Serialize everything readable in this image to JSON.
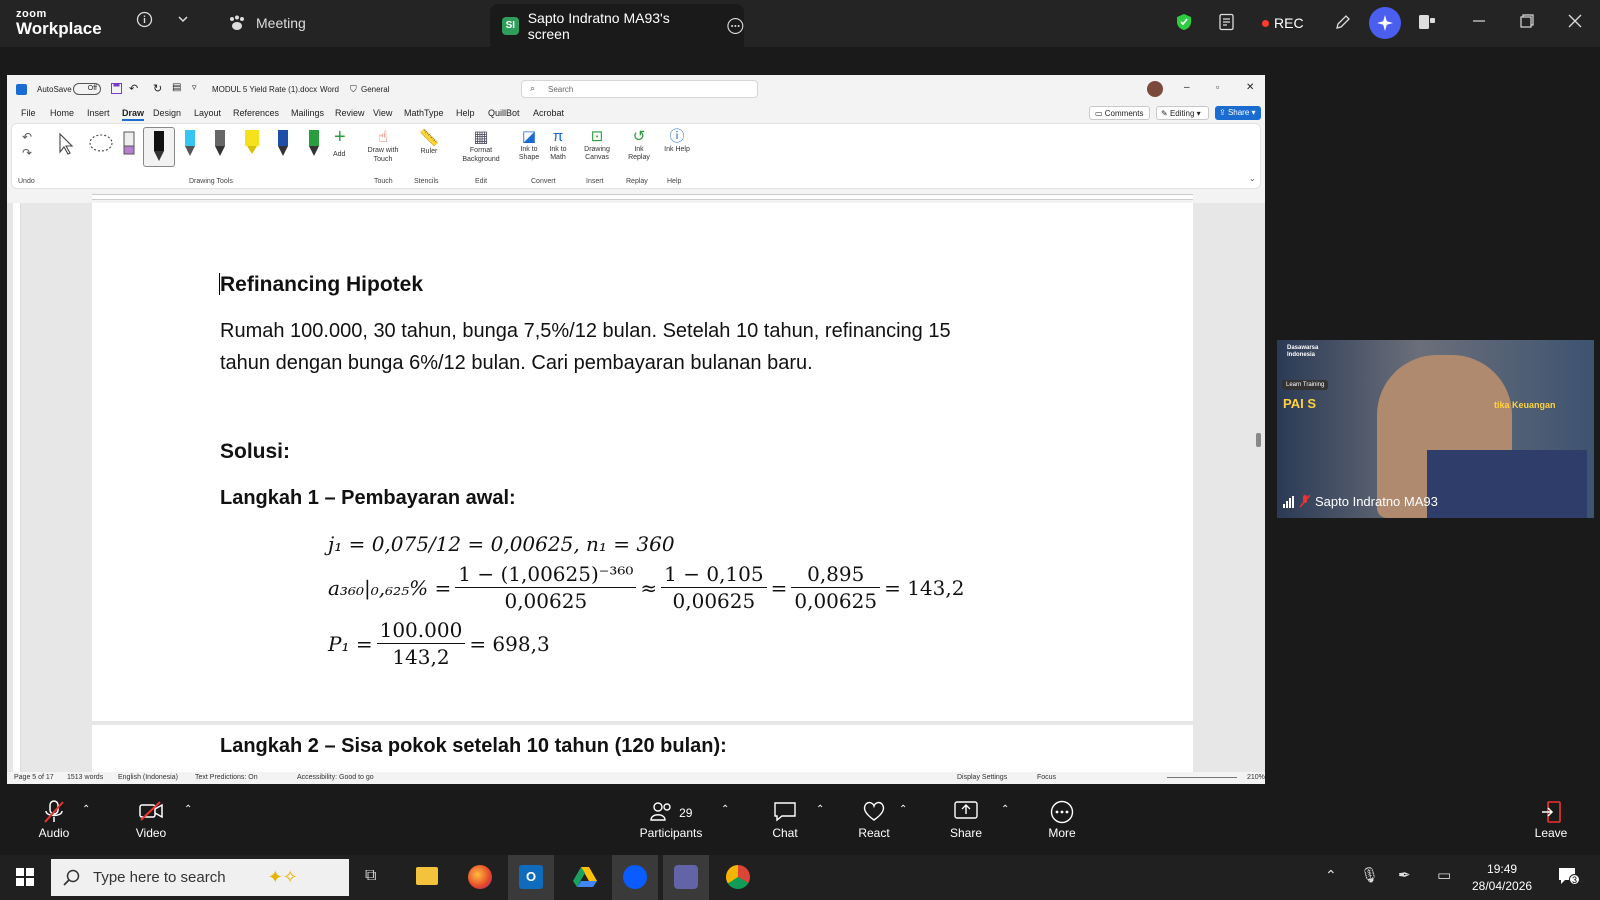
{
  "zoom": {
    "logo_line1": "zoom",
    "logo_line2": "Workplace",
    "meeting_label": "Meeting",
    "screen_tab_badge": "SI",
    "screen_tab_label": "Sapto Indratno MA93's screen",
    "rec_label": "REC"
  },
  "word": {
    "autosave": "AutoSave",
    "autosave_state": "Off",
    "filename": "MODUL 5 Yield Rate (1).docx",
    "app": "Word",
    "sensitivity": "General",
    "search_placeholder": "Search",
    "menu": [
      "File",
      "Home",
      "Insert",
      "Draw",
      "Design",
      "Layout",
      "References",
      "Mailings",
      "Review",
      "View",
      "MathType",
      "Help",
      "QuillBot",
      "Acrobat"
    ],
    "comments": "Comments",
    "editing": "Editing",
    "share": "Share",
    "ribbon": {
      "undo_group": "Undo",
      "drawing_tools_group": "Drawing Tools",
      "add": "Add",
      "draw_with_touch": "Draw with Touch",
      "ruler": "Ruler",
      "format_background": "Format Background",
      "ink_to_shape": "Ink to Shape",
      "ink_to_math": "Ink to Math",
      "drawing_canvas": "Drawing Canvas",
      "ink_replay": "Ink Replay",
      "ink_help": "Ink Help",
      "groups": [
        "Touch",
        "Stencils",
        "Edit",
        "Convert",
        "Insert",
        "Replay",
        "Help"
      ]
    },
    "status": {
      "page": "Page 5 of 17",
      "words": "1513 words",
      "language": "English (Indonesia)",
      "text_predictions": "Text Predictions: On",
      "accessibility": "Accessibility: Good to go",
      "display_settings": "Display Settings",
      "focus": "Focus",
      "zoom": "210%"
    }
  },
  "document": {
    "heading": "Refinancing Hipotek",
    "problem_line1": "Rumah 100.000, 30 tahun, bunga 7,5%/12 bulan. Setelah 10 tahun, refinancing 15",
    "problem_line2": "tahun dengan bunga 6%/12 bulan. Cari pembayaran bulanan baru.",
    "solusi": "Solusi:",
    "step1": "Langkah 1 – Pembayaran awal:",
    "eq1": "j₁ = 0,075/12 = 0,00625, n₁ = 360",
    "eq2_lhs": "a₃₆₀|₀,₆₂₅% =",
    "eq2_f1_num": "1 − (1,00625)⁻³⁶⁰",
    "eq2_f1_den": "0,00625",
    "eq2_approx": "≈",
    "eq2_f2_num": "1 − 0,105",
    "eq2_f2_den": "0,00625",
    "eq2_eq": "=",
    "eq2_f3_num": "0,895",
    "eq2_f3_den": "0,00625",
    "eq2_result": "= 143,2",
    "eq3_lhs": "P₁ =",
    "eq3_num": "100.000",
    "eq3_den": "143,2",
    "eq3_result": "= 698,3",
    "step2": "Langkah 2 – Sisa pokok setelah 10 tahun (120 bulan):"
  },
  "video": {
    "name": "Sapto Indratno MA93",
    "overlay_left": "PAI S",
    "overlay_right": "tika Keuangan",
    "chip": "Learn Training",
    "brand": "Dasawarsa Indonesia"
  },
  "bottom_bar": {
    "audio": "Audio",
    "video": "Video",
    "participants": "Participants",
    "participants_count": "29",
    "chat": "Chat",
    "react": "React",
    "share": "Share",
    "more": "More",
    "leave": "Leave"
  },
  "taskbar": {
    "search_placeholder": "Type here to search",
    "time": "19:49",
    "date": "28/04/2026",
    "notification_count": "3"
  }
}
